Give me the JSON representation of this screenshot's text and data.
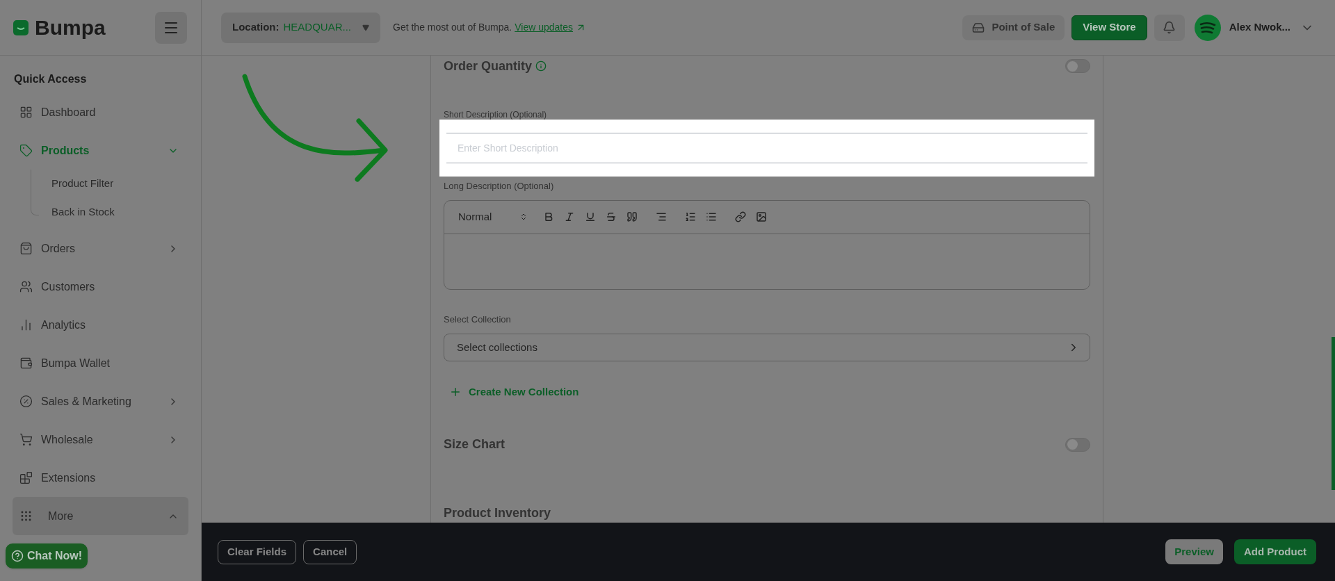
{
  "header": {
    "logo": "Bumpa",
    "location_label": "Location:",
    "location_value": "HEADQUAR...",
    "promo_text": "Get the most out of Bumpa.",
    "promo_link": "View updates",
    "point_of_sale": "Point of Sale",
    "view_store": "View Store",
    "user_name": "Alex Nwok..."
  },
  "sidebar": {
    "heading": "Quick Access",
    "items": [
      {
        "label": "Dashboard",
        "kind": "link",
        "selected": false
      },
      {
        "label": "Products",
        "kind": "group",
        "selected": true,
        "expanded": true,
        "children": [
          {
            "label": "Product Filter"
          },
          {
            "label": "Back in Stock"
          }
        ]
      },
      {
        "label": "Orders",
        "kind": "group",
        "selected": false,
        "expanded": false
      },
      {
        "label": "Customers",
        "kind": "link",
        "selected": false
      },
      {
        "label": "Analytics",
        "kind": "link",
        "selected": false
      },
      {
        "label": "Bumpa Wallet",
        "kind": "link",
        "selected": false
      },
      {
        "label": "Sales & Marketing",
        "kind": "group",
        "selected": false,
        "expanded": false
      },
      {
        "label": "Wholesale",
        "kind": "group",
        "selected": false,
        "expanded": false
      },
      {
        "label": "Extensions",
        "kind": "link",
        "selected": false
      },
      {
        "label": "More",
        "kind": "group",
        "selected": false,
        "expanded": true
      }
    ],
    "chat_button": "Chat Now!"
  },
  "form": {
    "order_quantity": {
      "label": "Order Quantity",
      "on": false
    },
    "short_description": {
      "label": "Short Description (Optional)",
      "placeholder": "Enter Short Description"
    },
    "long_description": {
      "label": "Long Description (Optional)",
      "format": "Normal"
    },
    "collection": {
      "label": "Select Collection",
      "value": "Select collections",
      "create_link": "Create New Collection"
    },
    "size_chart": {
      "label": "Size Chart",
      "on": false
    },
    "section_title": "Product Inventory"
  },
  "footer": {
    "buttons": [
      "Clear Fields",
      "Cancel"
    ],
    "preview": "Preview",
    "add_product": "Add Product"
  }
}
